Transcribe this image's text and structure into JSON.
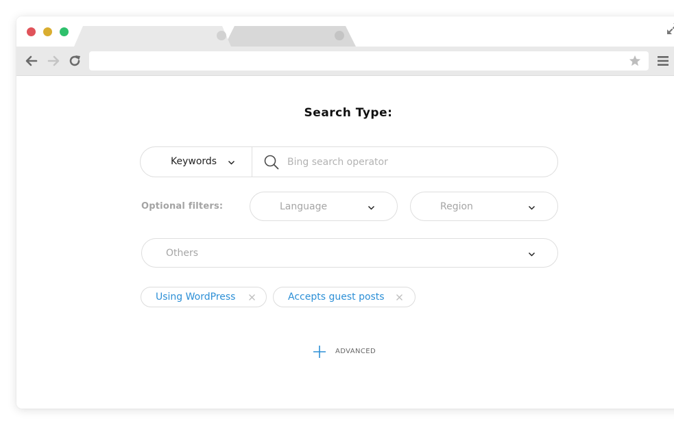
{
  "browser": {
    "address_value": "",
    "icons": {
      "back": "arrow-left-icon",
      "forward": "arrow-right-icon",
      "reload": "reload-icon",
      "bookmark": "star-icon",
      "menu": "hamburger-menu-icon",
      "fullscreen": "expand-arrows-icon"
    },
    "traffic_lights": [
      "#e0535a",
      "#d9ad30",
      "#2ec06c"
    ]
  },
  "page": {
    "title": "Search Type:"
  },
  "search": {
    "type_selected": "Keywords",
    "placeholder": "Bing search operator",
    "value": ""
  },
  "filters": {
    "label": "Optional filters:",
    "language": "Language",
    "region": "Region",
    "others": "Others"
  },
  "tags": [
    {
      "label": "Using WordPress"
    },
    {
      "label": "Accepts guest posts"
    }
  ],
  "advanced": {
    "label": "ADVANCED"
  },
  "colors": {
    "accent": "#2c8fd6",
    "muted_text": "#a5a5a5",
    "border": "#dedede"
  }
}
